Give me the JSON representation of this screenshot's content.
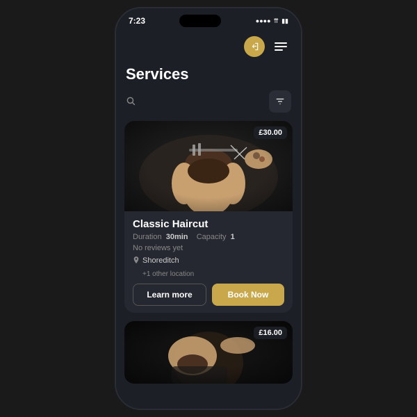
{
  "status_bar": {
    "time": "7:23"
  },
  "nav": {
    "login_icon": "→",
    "menu_icon": "≡"
  },
  "page": {
    "title": "Services"
  },
  "search": {
    "placeholder": "Search...",
    "filter_icon": "filter"
  },
  "cards": [
    {
      "id": "classic-haircut",
      "title": "Classic Haircut",
      "price": "£30.00",
      "duration_label": "Duration",
      "duration_value": "30min",
      "capacity_label": "Capacity",
      "capacity_value": "1",
      "reviews": "No reviews yet",
      "location": "Shoreditch",
      "location_more": "+1 other location",
      "learn_more": "Learn more",
      "book_now": "Book Now"
    },
    {
      "id": "service-2",
      "price": "£16.00"
    }
  ]
}
